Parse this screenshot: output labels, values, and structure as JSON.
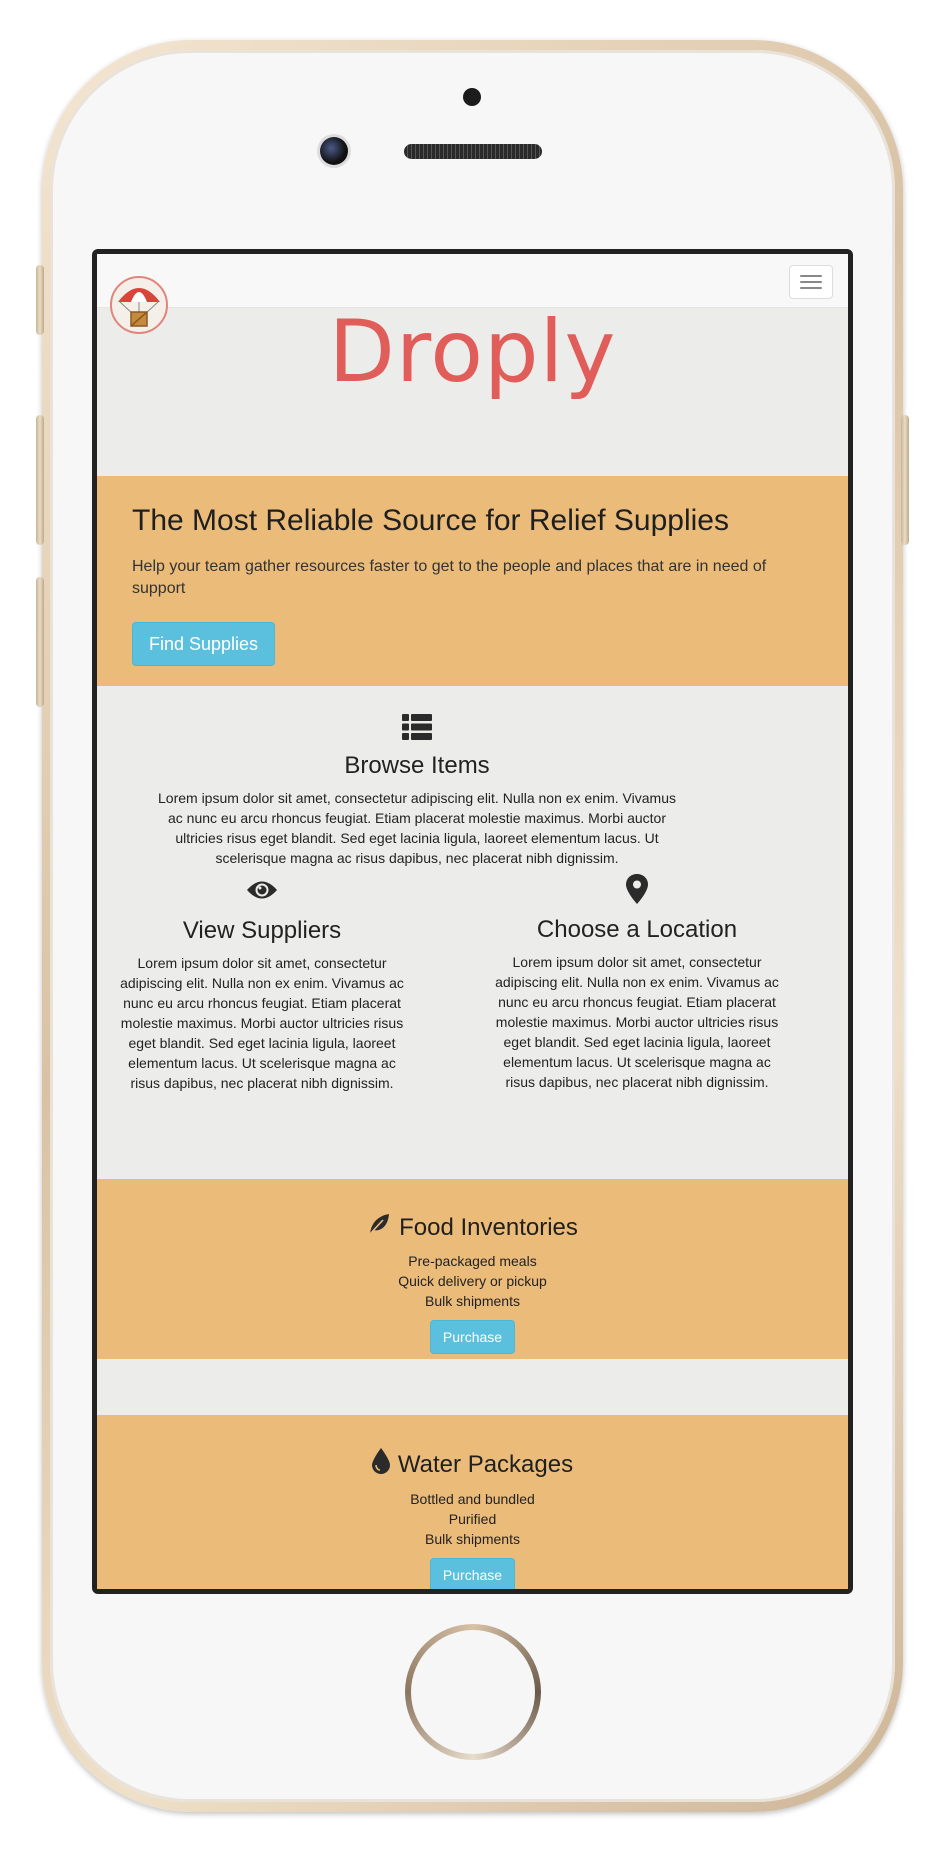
{
  "navbar": {
    "logo_icon": "parachute-crate-logo",
    "toggle_icon": "hamburger-icon"
  },
  "brand": {
    "title": "Droply",
    "color": "#e05d59"
  },
  "hero": {
    "heading": "The Most Reliable Source for Relief Supplies",
    "text": "Help your team gather resources faster to get to the people and places that are in need of support",
    "button": "Find Supplies"
  },
  "features": {
    "browse": {
      "icon": "list-icon",
      "title": "Browse Items",
      "text": "Lorem ipsum dolor sit amet, consectetur adipiscing elit. Nulla non ex enim. Vivamus ac nunc eu arcu rhoncus feugiat. Etiam placerat molestie maximus. Morbi auctor ultricies risus eget blandit. Sed eget lacinia ligula, laoreet elementum lacus. Ut scelerisque magna ac risus dapibus, nec placerat nibh dignissim."
    },
    "suppliers": {
      "icon": "eye-icon",
      "title": "View Suppliers",
      "text": "Lorem ipsum dolor sit amet, consectetur adipiscing elit. Nulla non ex enim. Vivamus ac nunc eu arcu rhoncus feugiat. Etiam placerat molestie maximus. Morbi auctor ultricies risus eget blandit. Sed eget lacinia ligula, laoreet elementum lacus. Ut scelerisque magna ac risus dapibus, nec placerat nibh dignissim."
    },
    "location": {
      "icon": "map-marker-icon",
      "title": "Choose a Location",
      "text": "Lorem ipsum dolor sit amet, consectetur adipiscing elit. Nulla non ex enim. Vivamus ac nunc eu arcu rhoncus feugiat. Etiam placerat molestie maximus. Morbi auctor ultricies risus eget blandit. Sed eget lacinia ligula, laoreet elementum lacus. Ut scelerisque magna ac risus dapibus, nec placerat nibh dignissim."
    }
  },
  "panels": {
    "food": {
      "icon": "leaf-icon",
      "title": "Food Inventories",
      "lines": [
        "Pre-packaged meals",
        "Quick delivery or pickup",
        "Bulk shipments"
      ],
      "button": "Purchase"
    },
    "water": {
      "icon": "tint-icon",
      "title": "Water Packages",
      "lines": [
        "Bottled and bundled",
        "Purified",
        "Bulk shipments"
      ],
      "button": "Purchase"
    }
  },
  "colors": {
    "panel_bg": "#ebbb79",
    "button_info": "#5bc0de",
    "page_bg": "#ecedeb"
  }
}
